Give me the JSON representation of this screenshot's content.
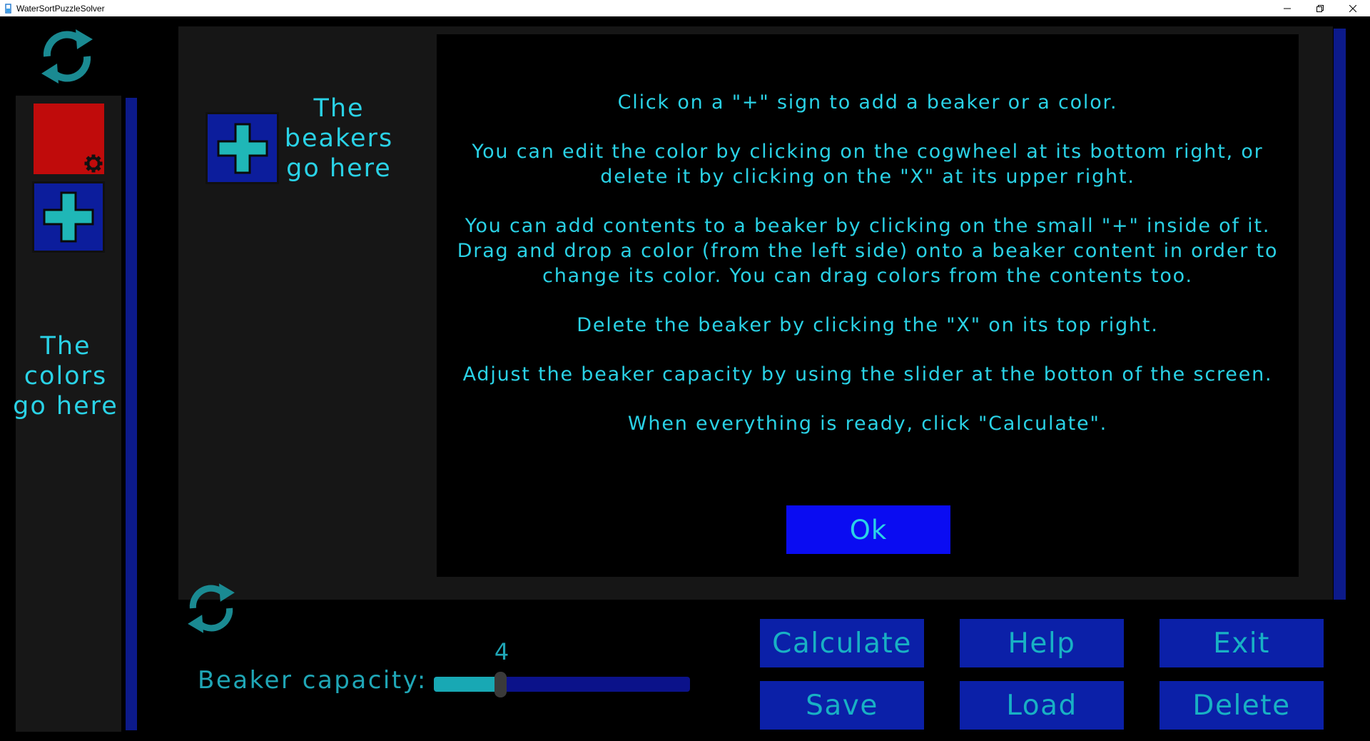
{
  "window": {
    "title": "WaterSortPuzzleSolver",
    "minimize_icon": "minimize-icon",
    "restore_icon": "restore-icon",
    "close_icon": "close-icon"
  },
  "colors_panel": {
    "hint": "The\ncolors\ngo here",
    "swatches": [
      {
        "color": "#c00b0b",
        "edit_icon": "cogwheel-icon"
      }
    ],
    "add_icon": "plus-icon",
    "reset_icon": "refresh-icon"
  },
  "beakers_panel": {
    "hint": "The\nbeakers\ngo here",
    "add_icon": "plus-icon",
    "reset_icon": "refresh-icon"
  },
  "help_dialog": {
    "paragraphs": [
      "Click on a \"+\" sign to add a beaker or a color.",
      "You can edit the color by clicking on the cogwheel at its bottom right, or\ndelete it by clicking on the \"X\" at its upper right.",
      "You can add contents to a beaker by clicking on the small \"+\" inside of it.\nDrag and drop a color (from the left side) onto a beaker content in order to\nchange its color. You can drag colors from the contents too.",
      "Delete the beaker by clicking the \"X\" on its top right.",
      "Adjust the beaker capacity by using the slider at the botton of the screen.",
      "When everything is ready, click \"Calculate\"."
    ],
    "ok_label": "Ok"
  },
  "capacity": {
    "label": "Beaker capacity:",
    "value": "4",
    "slider_fraction": 0.26
  },
  "buttons": {
    "calculate": "Calculate",
    "help": "Help",
    "exit": "Exit",
    "save": "Save",
    "load": "Load",
    "delete": "Delete"
  },
  "theme": {
    "accent_text": "#2ad2e6",
    "button_bg": "#0b20a8",
    "ok_bg": "#0a0cf2",
    "plus_tile_bg": "#0c1d9c",
    "plus_cross": "#1fb7b7",
    "scrollbar": "#0c1a8a"
  }
}
